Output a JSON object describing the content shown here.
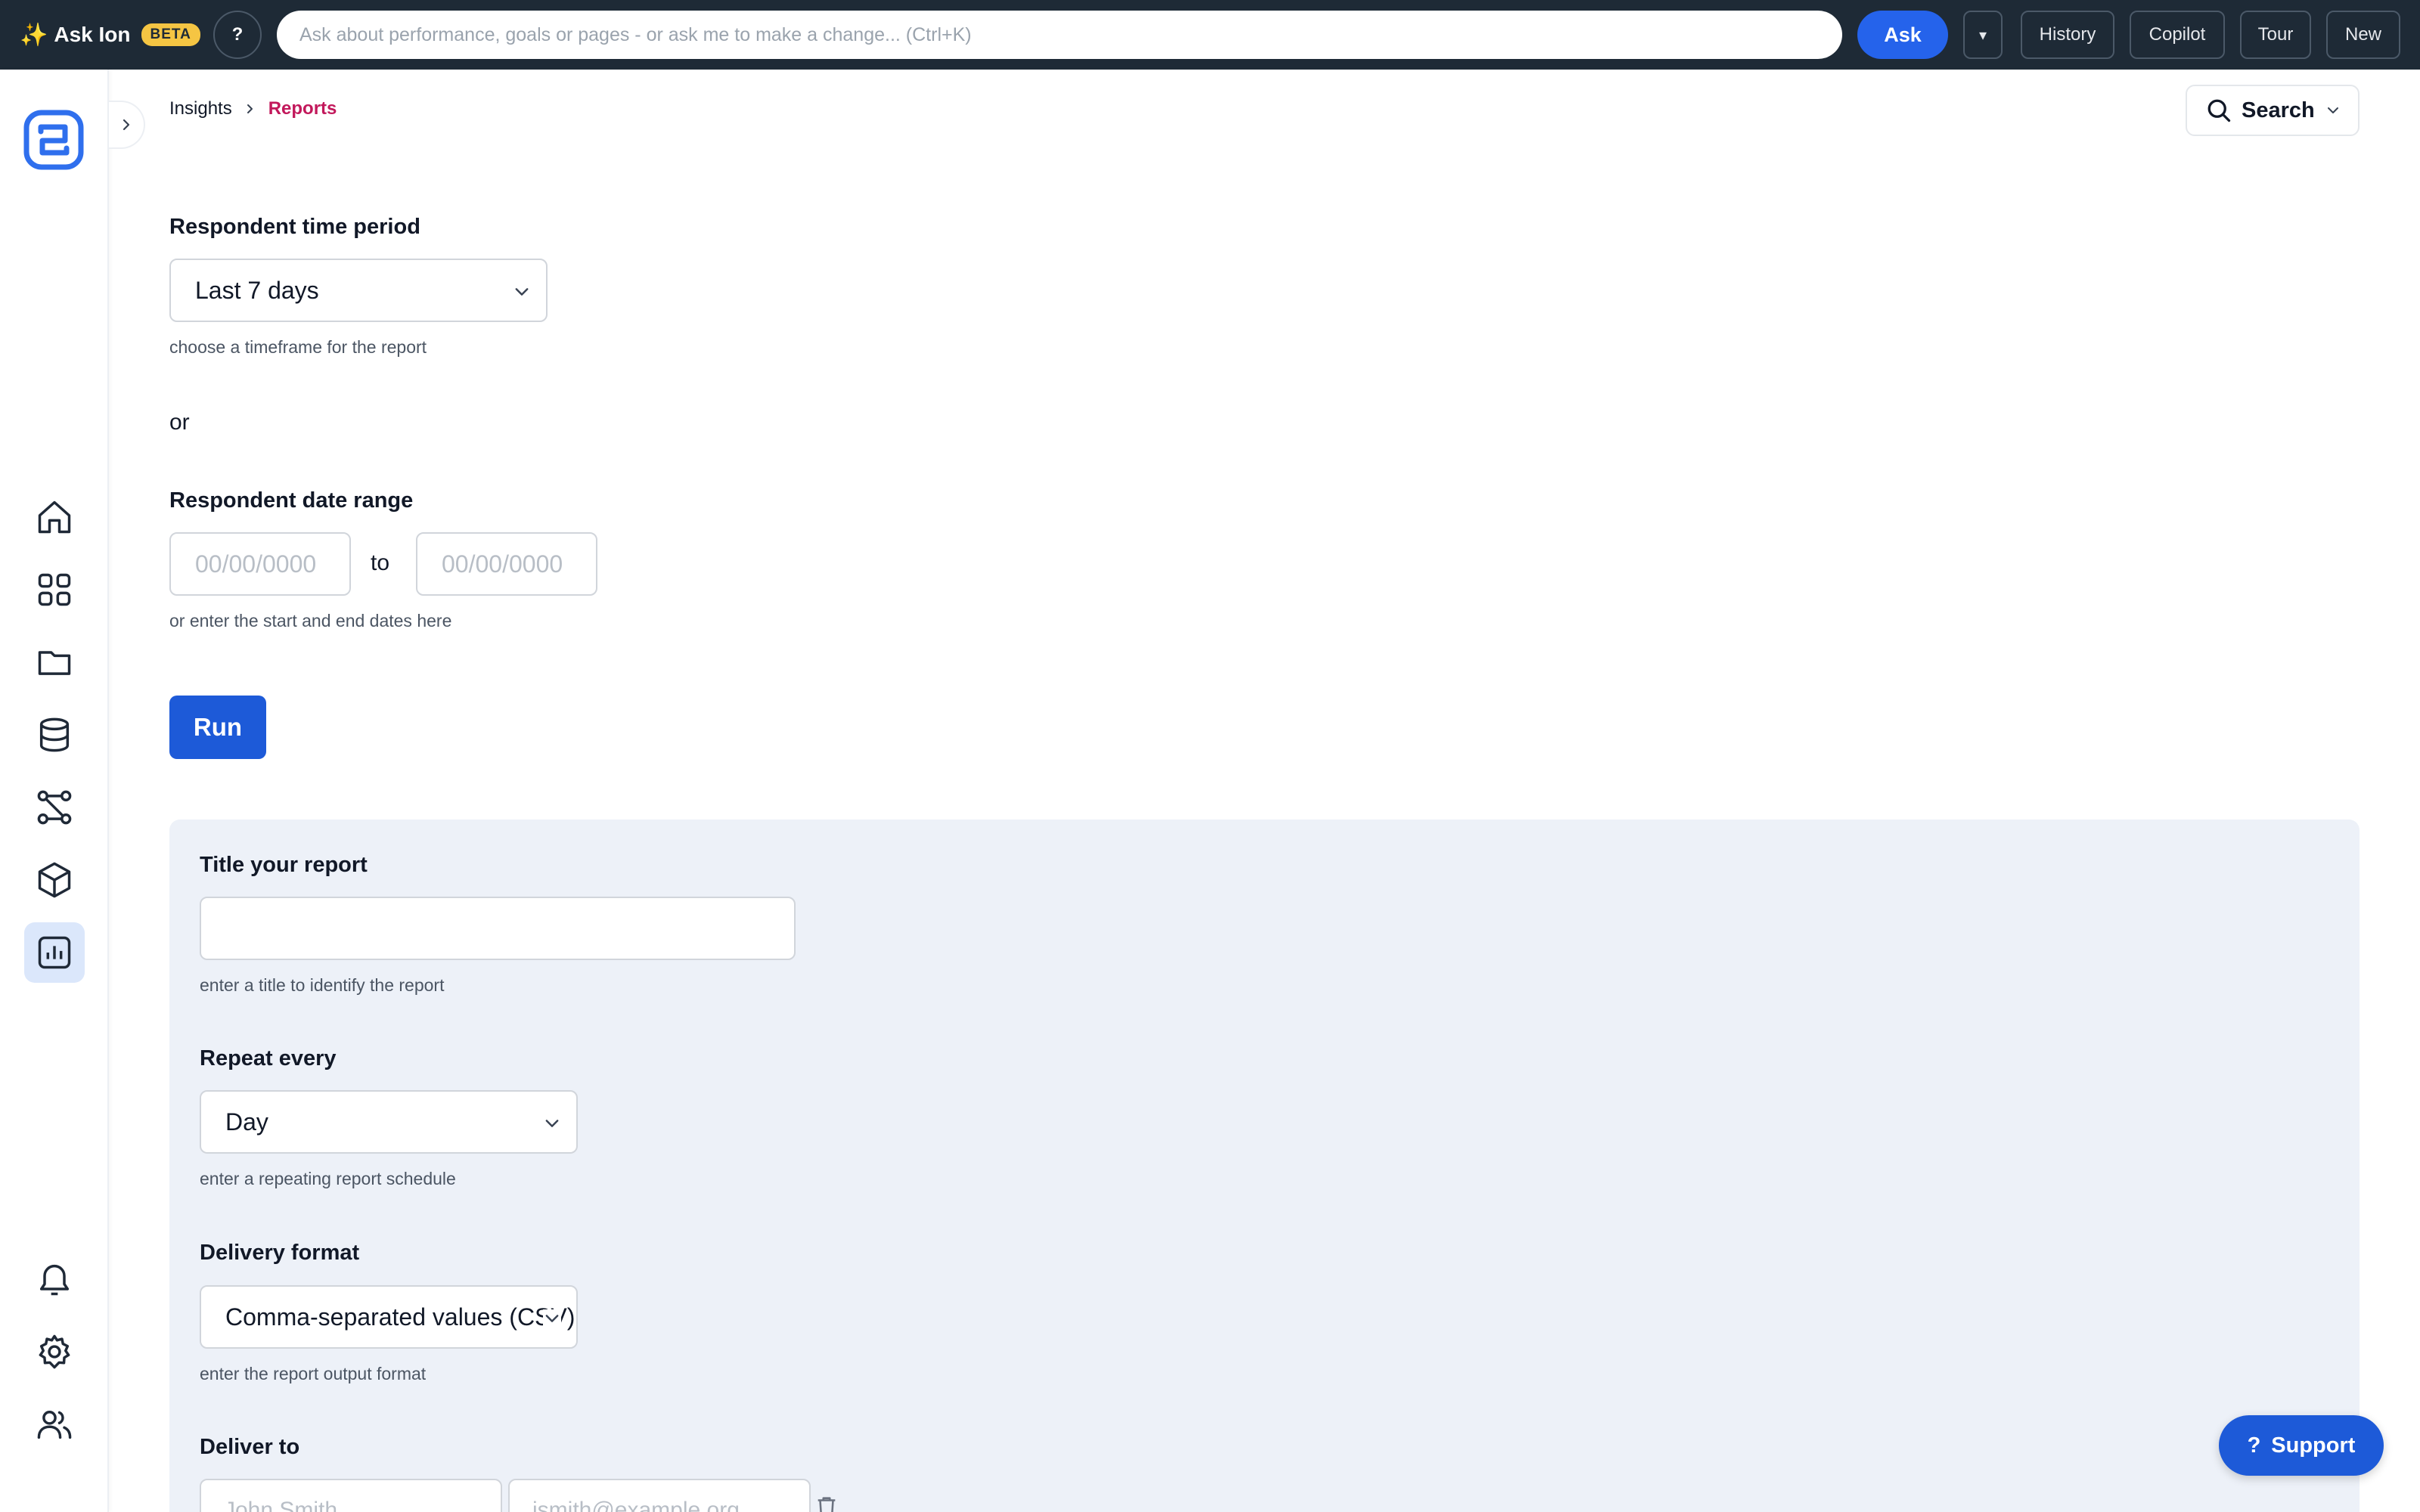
{
  "topbar": {
    "brand_label": "Ask Ion",
    "brand_spark": "✨",
    "badge": "BETA",
    "help_label": "?",
    "ask_placeholder": "Ask about performance, goals or pages - or ask me to make a change... (Ctrl+K)",
    "ask_button": "Ask",
    "caret_label": "▾",
    "history_button": "History",
    "copilot_button": "Copilot",
    "tour_button": "Tour",
    "new_button": "New"
  },
  "sidebar": {
    "items": [
      {
        "icon": "home-icon"
      },
      {
        "icon": "grid-icon"
      },
      {
        "icon": "folder-icon"
      },
      {
        "icon": "database-icon"
      },
      {
        "icon": "workflow-icon"
      },
      {
        "icon": "cube-icon"
      },
      {
        "icon": "bar-chart-icon",
        "active": true
      }
    ],
    "bottom_items": [
      {
        "icon": "bell-icon"
      },
      {
        "icon": "gear-icon"
      },
      {
        "icon": "users-icon"
      }
    ]
  },
  "breadcrumb": {
    "parent": "Insights",
    "current": "Reports"
  },
  "search": {
    "label": "Search"
  },
  "time_period": {
    "label": "Respondent time period",
    "value": "Last 7 days",
    "hint": "choose a timeframe for the report"
  },
  "or_text": "or",
  "date_range": {
    "label": "Respondent date range",
    "start_placeholder": "00/00/0000",
    "end_placeholder": "00/00/0000",
    "to_text": "to",
    "hint": "or enter the start and end dates here"
  },
  "run_button": "Run",
  "schedule": {
    "title_label": "Title your report",
    "title_value": "",
    "title_hint": "enter a title to identify the report",
    "repeat_label": "Repeat every",
    "repeat_value": "Day",
    "repeat_hint": "enter a repeating report schedule",
    "format_label": "Delivery format",
    "format_value": "Comma-separated values (CSV)",
    "format_hint": "enter the report output format",
    "deliver_label": "Deliver to",
    "name_placeholder": "John Smith",
    "email_placeholder": "jsmith@example.org"
  },
  "support_button": "Support",
  "colors": {
    "topbar_bg": "#1e2a36",
    "accent_blue": "#1d5ad8",
    "breadcrumb_active": "#c2185b",
    "panel_bg": "#edf1f8",
    "beta_badge": "#f5c543"
  }
}
